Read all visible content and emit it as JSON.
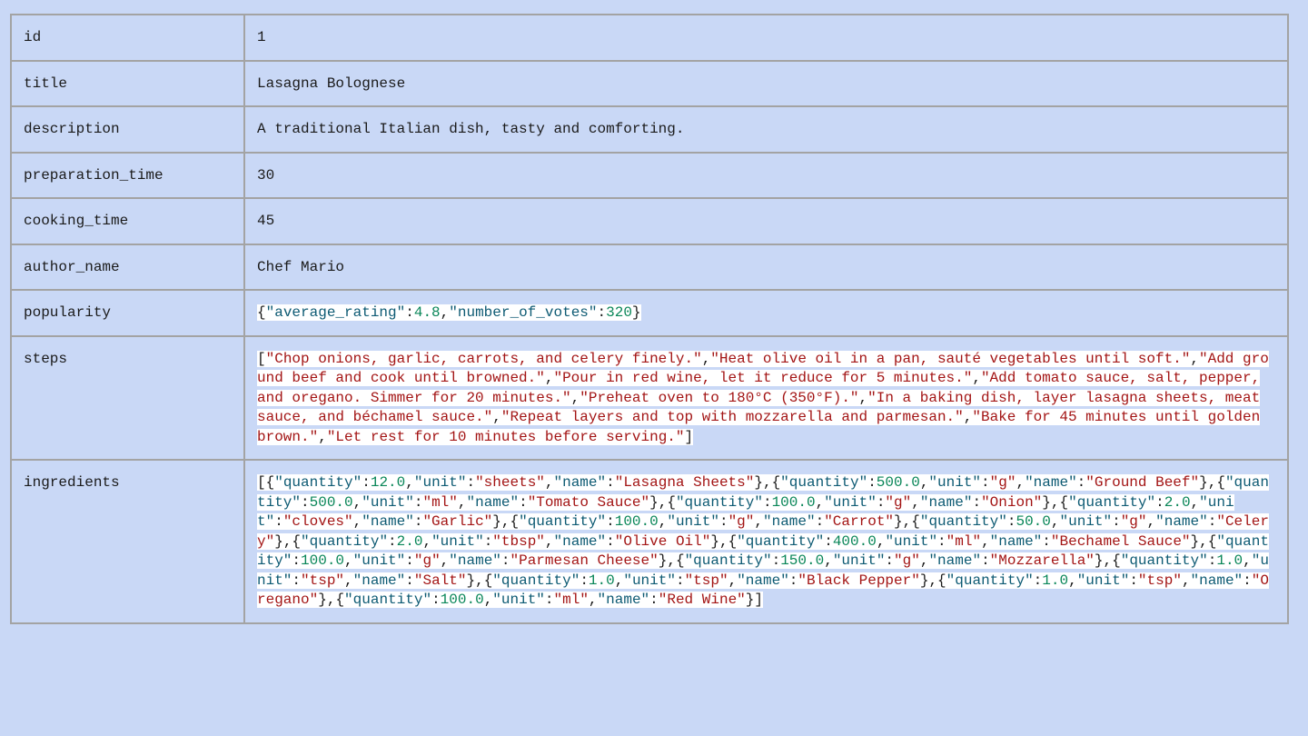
{
  "rows": [
    {
      "key": "id",
      "value": "1"
    },
    {
      "key": "title",
      "value": "Lasagna Bolognese"
    },
    {
      "key": "description",
      "value": "A traditional Italian dish, tasty and comforting."
    },
    {
      "key": "preparation_time",
      "value": "30"
    },
    {
      "key": "cooking_time",
      "value": "45"
    },
    {
      "key": "author_name",
      "value": "Chef Mario"
    },
    {
      "key": "popularity",
      "value": "{\"average_rating\":4.8,\"number_of_votes\":320}"
    },
    {
      "key": "steps",
      "value": "[\"Chop onions, garlic, carrots, and celery finely.\",\"Heat olive oil in a pan, sauté vegetables until soft.\",\"Add ground beef and cook until browned.\",\"Pour in red wine, let it reduce for 5 minutes.\",\"Add tomato sauce, salt, pepper, and oregano. Simmer for 20 minutes.\",\"Preheat oven to 180°C (350°F).\",\"In a baking dish, layer lasagna sheets, meat sauce, and béchamel sauce.\",\"Repeat layers and top with mozzarella and parmesan.\",\"Bake for 45 minutes until golden brown.\",\"Let rest for 10 minutes before serving.\"]"
    },
    {
      "key": "ingredients",
      "value": "[{\"quantity\":12.0,\"unit\":\"sheets\",\"name\":\"Lasagna Sheets\"},{\"quantity\":500.0,\"unit\":\"g\",\"name\":\"Ground Beef\"},{\"quantity\":500.0,\"unit\":\"ml\",\"name\":\"Tomato Sauce\"},{\"quantity\":100.0,\"unit\":\"g\",\"name\":\"Onion\"},{\"quantity\":2.0,\"unit\":\"cloves\",\"name\":\"Garlic\"},{\"quantity\":100.0,\"unit\":\"g\",\"name\":\"Carrot\"},{\"quantity\":50.0,\"unit\":\"g\",\"name\":\"Celery\"},{\"quantity\":2.0,\"unit\":\"tbsp\",\"name\":\"Olive Oil\"},{\"quantity\":400.0,\"unit\":\"ml\",\"name\":\"Bechamel Sauce\"},{\"quantity\":100.0,\"unit\":\"g\",\"name\":\"Parmesan Cheese\"},{\"quantity\":150.0,\"unit\":\"g\",\"name\":\"Mozzarella\"},{\"quantity\":1.0,\"unit\":\"tsp\",\"name\":\"Salt\"},{\"quantity\":1.0,\"unit\":\"tsp\",\"name\":\"Black Pepper\"},{\"quantity\":1.0,\"unit\":\"tsp\",\"name\":\"Oregano\"},{\"quantity\":100.0,\"unit\":\"ml\",\"name\":\"Red Wine\"}]"
    }
  ]
}
